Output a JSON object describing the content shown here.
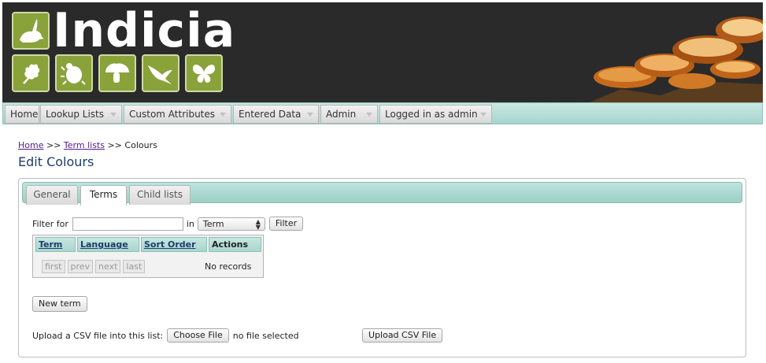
{
  "brand": {
    "name": "Indicia",
    "green": "#8aa23a",
    "dark": "#2a2a2a"
  },
  "nav": {
    "items": [
      {
        "label": "Home",
        "dropdown": false
      },
      {
        "label": "Lookup Lists",
        "dropdown": true
      },
      {
        "label": "Custom Attributes",
        "dropdown": true
      },
      {
        "label": "Entered Data",
        "dropdown": true
      },
      {
        "label": "Admin",
        "dropdown": true
      },
      {
        "label": "Logged in as admin",
        "dropdown": true
      }
    ]
  },
  "breadcrumb": {
    "home": "Home",
    "sep1": ">>",
    "term_lists": "Term lists",
    "sep2": ">>",
    "current": "Colours"
  },
  "page": {
    "title": "Edit Colours"
  },
  "tabs": [
    {
      "label": "General",
      "active": false
    },
    {
      "label": "Terms",
      "active": true
    },
    {
      "label": "Child lists",
      "active": false
    }
  ],
  "filter": {
    "label": "Filter for",
    "value": "",
    "in_label": "in",
    "field_selected": "Term",
    "button": "Filter"
  },
  "grid": {
    "columns": [
      {
        "label": "Term",
        "sortable": true
      },
      {
        "label": "Language",
        "sortable": true
      },
      {
        "label": "Sort Order",
        "sortable": true
      },
      {
        "label": "Actions",
        "sortable": false
      }
    ],
    "pager": [
      "first",
      "prev",
      "next",
      "last"
    ],
    "empty_text": "No records"
  },
  "actions": {
    "new_term": "New term"
  },
  "upload": {
    "label": "Upload a CSV file into this list:",
    "choose_button": "Choose File",
    "no_file": "no file selected",
    "upload_button": "Upload CSV File"
  }
}
